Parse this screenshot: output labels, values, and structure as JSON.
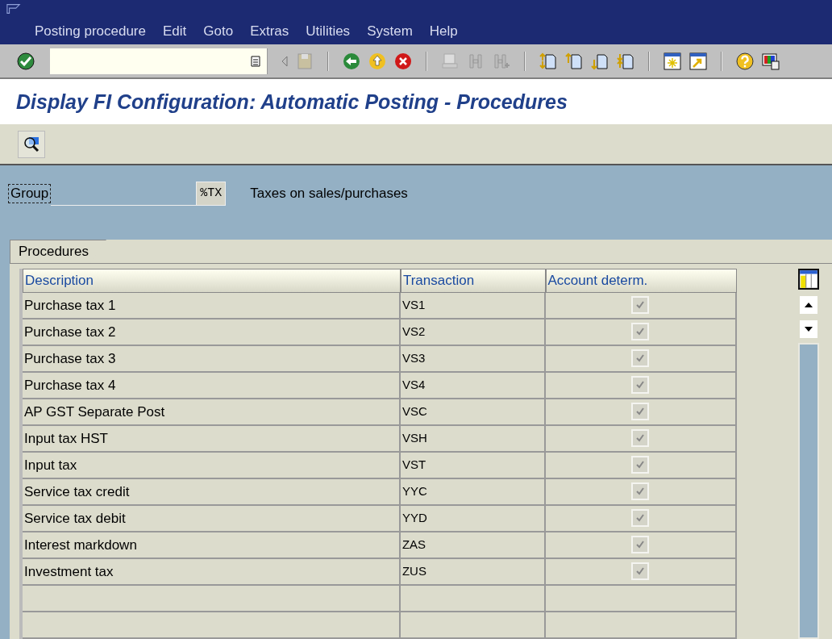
{
  "menu": [
    "Posting procedure",
    "Edit",
    "Goto",
    "Extras",
    "Utilities",
    "System",
    "Help"
  ],
  "title": "Display FI Configuration: Automatic Posting - Procedures",
  "group": {
    "label": "Group",
    "value": "%TX",
    "description": "Taxes on sales/purchases"
  },
  "tabs": [
    {
      "label": "Procedures",
      "selected": true
    }
  ],
  "table": {
    "columns": [
      "Description",
      "Transaction",
      "Account determ."
    ],
    "rows": [
      {
        "description": "Purchase tax 1",
        "transaction": "VS1",
        "account_determ": true
      },
      {
        "description": "Purchase tax 2",
        "transaction": "VS2",
        "account_determ": true
      },
      {
        "description": "Purchase tax 3",
        "transaction": "VS3",
        "account_determ": true
      },
      {
        "description": "Purchase tax 4",
        "transaction": "VS4",
        "account_determ": true
      },
      {
        "description": "AP GST Separate Post",
        "transaction": "VSC",
        "account_determ": true
      },
      {
        "description": "Input tax HST",
        "transaction": "VSH",
        "account_determ": true
      },
      {
        "description": "Input tax",
        "transaction": "VST",
        "account_determ": true
      },
      {
        "description": "Service tax credit",
        "transaction": "YYC",
        "account_determ": true
      },
      {
        "description": "Service tax debit",
        "transaction": "YYD",
        "account_determ": true
      },
      {
        "description": "Interest markdown",
        "transaction": "ZAS",
        "account_determ": true
      },
      {
        "description": "Investment tax",
        "transaction": "ZUS",
        "account_determ": true
      }
    ]
  }
}
